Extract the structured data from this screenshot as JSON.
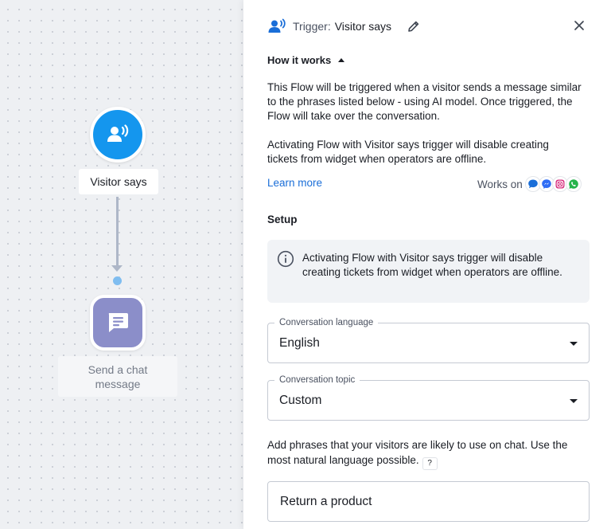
{
  "canvas": {
    "trigger_node": {
      "label": "Visitor says"
    },
    "action_node": {
      "label": "Send a chat message"
    }
  },
  "panel": {
    "header": {
      "prefix": "Trigger:",
      "title": "Visitor says"
    },
    "how_it_works": {
      "title": "How it works",
      "paragraph1": "This Flow will be triggered when a visitor sends a message similar to the phrases listed below - using AI model. Once triggered, the Flow will take over the conversation.",
      "paragraph2": "Activating Flow with Visitor says trigger will disable creating tickets from widget when operators are offline.",
      "learn_more": "Learn more",
      "works_on_label": "Works on"
    },
    "setup": {
      "title": "Setup",
      "info_text": "Activating Flow with Visitor says trigger will disable creating tickets from widget when operators are offline.",
      "language": {
        "legend": "Conversation language",
        "value": "English"
      },
      "topic": {
        "legend": "Conversation topic",
        "value": "Custom"
      },
      "phrases_help": "Add phrases that your visitors are likely to use on chat. Use the most natural language possible.",
      "help_badge": "?",
      "phrase_value": "Return a product"
    }
  },
  "colors": {
    "accent_blue": "#1496ee",
    "action_purple": "#8b8ec9",
    "link": "#1a6ed8"
  },
  "icons": {
    "trigger": "speaking-person-icon",
    "action": "chat-message-icon",
    "edit": "pencil-icon",
    "close": "close-icon",
    "info": "info-icon",
    "channels": [
      "livechat-icon",
      "messenger-icon",
      "instagram-icon",
      "whatsapp-icon"
    ]
  }
}
